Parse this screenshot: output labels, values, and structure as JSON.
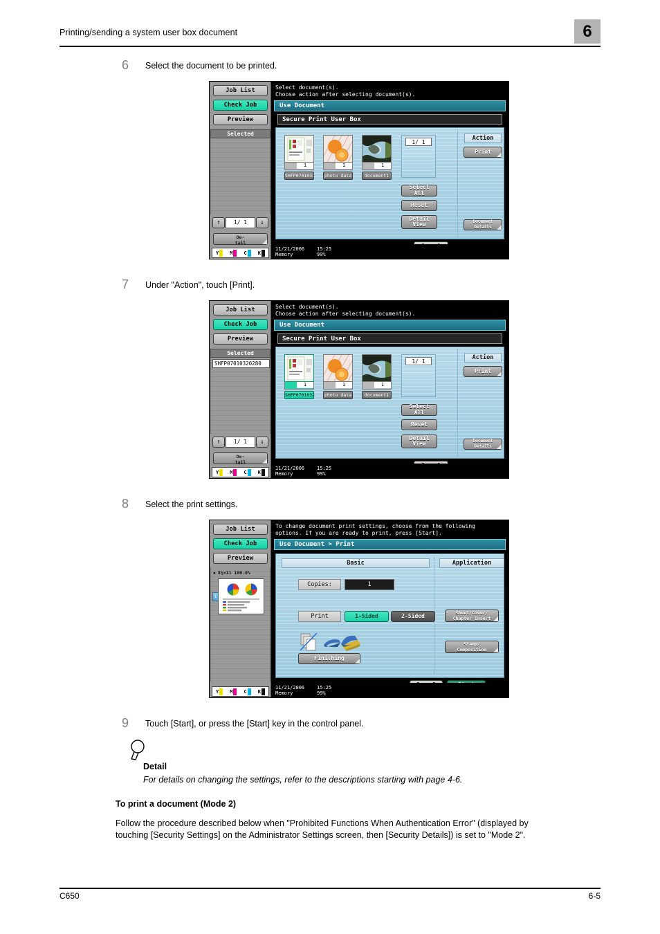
{
  "header": {
    "title": "Printing/sending a system user box document",
    "chapter": "6"
  },
  "steps": [
    {
      "num": "6",
      "text": "Select the document to be printed."
    },
    {
      "num": "7",
      "text": "Under \"Action\", touch [Print]."
    },
    {
      "num": "8",
      "text": "Select the print settings."
    },
    {
      "num": "9",
      "text": "Touch [Start], or press the [Start] key in the control panel."
    }
  ],
  "panel1": {
    "side": {
      "job_list": "Job List",
      "check_job": "Check Job",
      "preview": "Preview",
      "selected_documents": "Selected Documents",
      "selected_items": [],
      "page_indicator": "1/  1",
      "arrow_up": "↑",
      "arrow_down": "↓",
      "detail": "De-\ntail",
      "toner": [
        "Y",
        "M",
        "C",
        "K"
      ]
    },
    "message": "Select document(s).\nChoose action after selecting document(s).",
    "breadcrumb": "Use Document",
    "box_name": "Secure Print User Box",
    "documents": [
      {
        "name": "SHFP0701032",
        "count": "1",
        "selected": false
      },
      {
        "name": "photo data",
        "count": "1",
        "selected": false
      },
      {
        "name": "document1",
        "count": "1",
        "selected": false
      }
    ],
    "page_count": "1/  1",
    "buttons": {
      "select_all": "Select\nAll",
      "reset": "Reset",
      "detail_view": "Detail\nView",
      "document_details": "Document\nDetails",
      "cancel": "Cancel"
    },
    "action_label": "Action",
    "action_print": "Print",
    "status": {
      "date": "11/21/2006",
      "time": "15:25",
      "memory_label": "Memory",
      "memory_value": "99%"
    }
  },
  "panel2": {
    "side": {
      "job_list": "Job List",
      "check_job": "Check Job",
      "preview": "Preview",
      "selected_documents": "Selected Documents",
      "selected_items": [
        "SHFP07010320280"
      ],
      "page_indicator": "1/  1",
      "arrow_up": "↑",
      "arrow_down": "↓",
      "detail": "De-\ntail",
      "toner": [
        "Y",
        "M",
        "C",
        "K"
      ]
    },
    "message": "Select document(s).\nChoose action after selecting document(s).",
    "breadcrumb": "Use Document",
    "box_name": "Secure Print User Box",
    "documents": [
      {
        "name": "SHFP0701032",
        "count": "1",
        "selected": true
      },
      {
        "name": "photo data",
        "count": "1",
        "selected": false
      },
      {
        "name": "document1",
        "count": "1",
        "selected": false
      }
    ],
    "page_count": "1/  1",
    "buttons": {
      "select_all": "Select\nAll",
      "reset": "Reset",
      "detail_view": "Detail\nView",
      "document_details": "Document\nDetails",
      "cancel": "Cancel"
    },
    "action_label": "Action",
    "action_print": "Print",
    "status": {
      "date": "11/21/2006",
      "time": "15:25",
      "memory_label": "Memory",
      "memory_value": "99%"
    }
  },
  "panel3": {
    "side": {
      "job_list": "Job List",
      "check_job": "Check Job",
      "preview": "Preview",
      "preview_info": "8½×11   100.0%",
      "toner": [
        "Y",
        "M",
        "C",
        "K"
      ]
    },
    "message": "To change document print settings, choose from the following\noptions. If you are ready to print, press [Start].",
    "breadcrumb": "Use Document > Print",
    "tabs": {
      "basic": "Basic",
      "application": "Application"
    },
    "copies_label": "Copies:",
    "copies_value": "1",
    "print_label": "Print",
    "sided_1": "1-Sided",
    "sided_2": "2-Sided",
    "finishing": "Finishing",
    "app_buttons": {
      "sheet_cover_chapter": "Sheet/Cover/\nChapter Insert",
      "stamp_composition": "Stamp/\nComposition"
    },
    "cancel": "Cancel",
    "start": "Start",
    "status": {
      "date": "11/21/2006",
      "time": "15:25",
      "memory_label": "Memory",
      "memory_value": "99%"
    }
  },
  "detail_note": {
    "icon": "magnifier-icon",
    "title": "Detail",
    "text": "For details on changing the settings, refer to the descriptions starting with page 4-6."
  },
  "section": {
    "heading": "To print a document (Mode 2)",
    "paragraph_line1": "Follow the procedure described below when \"Prohibited Functions When Authentication Error\" (displayed by",
    "paragraph_line2": "touching [Security Settings] on the Administrator Settings screen, then [Security Details]) is set to \"Mode 2\"."
  },
  "footer": {
    "left": "C650",
    "right": "6-5"
  },
  "colors": {
    "accent_teal": "#2e8fa3",
    "accent_green": "#13d2a4",
    "panel_blue": "#a9d2e4",
    "chapter_gray": "#b3b3b3"
  }
}
